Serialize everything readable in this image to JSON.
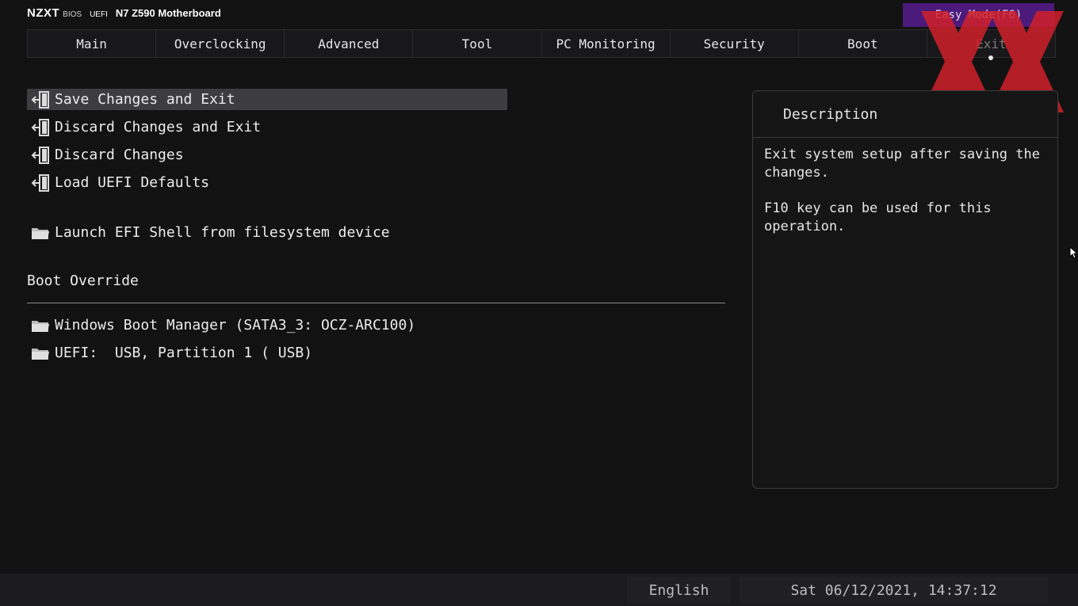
{
  "header": {
    "brand_logo": "NZXT",
    "brand_bios": "BIOS",
    "brand_uefi": "UEFI",
    "model": "N7 Z590 Motherboard",
    "easy_mode_label": "Easy Mode(F6)"
  },
  "tabs": [
    {
      "label": "Main",
      "active": false
    },
    {
      "label": "Overclocking",
      "active": false
    },
    {
      "label": "Advanced",
      "active": false
    },
    {
      "label": "Tool",
      "active": false
    },
    {
      "label": "PC Monitoring",
      "active": false
    },
    {
      "label": "Security",
      "active": false
    },
    {
      "label": "Boot",
      "active": false
    },
    {
      "label": "Exit",
      "active": true
    }
  ],
  "menu": {
    "items": [
      {
        "label": "Save Changes and Exit",
        "icon": "exit-door-icon",
        "selected": true
      },
      {
        "label": "Discard Changes and Exit",
        "icon": "exit-door-icon",
        "selected": false
      },
      {
        "label": "Discard Changes",
        "icon": "exit-door-icon",
        "selected": false
      },
      {
        "label": "Load UEFI Defaults",
        "icon": "exit-door-icon",
        "selected": false
      },
      {
        "label": "Launch EFI Shell from filesystem device",
        "icon": "folder-icon",
        "selected": false
      }
    ],
    "boot_override_title": "Boot Override",
    "boot_items": [
      {
        "label": "Windows Boot Manager (SATA3_3: OCZ-ARC100)",
        "icon": "folder-icon"
      },
      {
        "label": "UEFI:  USB, Partition 1 ( USB)",
        "icon": "folder-icon"
      }
    ]
  },
  "description": {
    "title": "Description",
    "paragraphs": [
      "Exit system setup after saving the changes.",
      "F10 key can be used for this operation."
    ]
  },
  "footer": {
    "language": "English",
    "datetime": "Sat 06/12/2021, 14:37:12"
  },
  "colors": {
    "background": "#121213",
    "accent_purple": "#4b1a7a",
    "selected_row": "#3d3d3f",
    "watermark_red": "#d0202a"
  }
}
